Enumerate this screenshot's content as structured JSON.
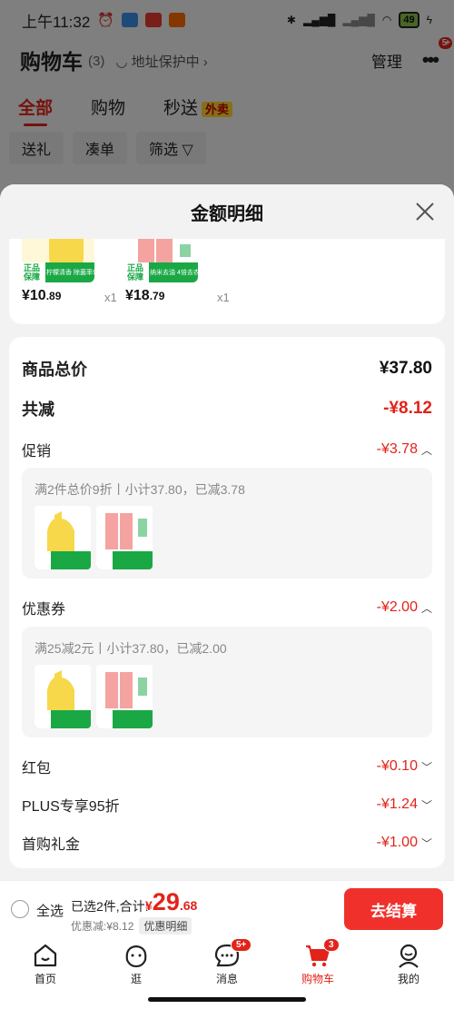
{
  "status_bar": {
    "time": "上午11:32",
    "battery": "49"
  },
  "cart_header": {
    "title": "购物车",
    "count": "(3)",
    "address_protect": "地址保护中",
    "manage": "管理",
    "more_badge": "5+"
  },
  "tabs": [
    {
      "label": "全部"
    },
    {
      "label": "购物"
    },
    {
      "label": "秒送"
    }
  ],
  "tab_tag": "外卖",
  "chips": [
    "送礼",
    "凑单",
    "筛选"
  ],
  "sheet": {
    "title": "金额明细",
    "products": [
      {
        "price_int": "¥10",
        "price_dec": ".89",
        "qty": "x1",
        "badge": "正品保障",
        "caption": "柠檬清香 除菌率99.9%"
      },
      {
        "price_int": "¥18",
        "price_dec": ".79",
        "qty": "x1",
        "badge": "正品保障",
        "caption": "纳米去油 4倍去农残"
      }
    ],
    "total_label": "商品总价",
    "total_value": "¥37.80",
    "reduce_label": "共减",
    "reduce_value": "-¥8.12",
    "promo_label": "促销",
    "promo_value": "-¥3.78",
    "promo_text": "满2件总价9折丨小计37.80，已减3.78",
    "coupon_label": "优惠券",
    "coupon_value": "-¥2.00",
    "coupon_text": "满25减2元丨小计37.80，已减2.00",
    "redpack_label": "红包",
    "redpack_value": "-¥0.10",
    "plus_label": "PLUS专享95折",
    "plus_value": "-¥1.24",
    "firstbuy_label": "首购礼金",
    "firstbuy_value": "-¥1.00"
  },
  "checkout": {
    "select_all": "全选",
    "selected_summary": "已选2件,合计:",
    "total_yen": "¥",
    "total_int": "29",
    "total_dec": ".68",
    "discount": "优惠减:¥8.12",
    "discount_detail": "优惠明细",
    "button": "去结算"
  },
  "nav": [
    {
      "label": "首页"
    },
    {
      "label": "逛"
    },
    {
      "label": "消息",
      "badge": "5+"
    },
    {
      "label": "购物车",
      "badge": "3"
    },
    {
      "label": "我的"
    }
  ],
  "colors": {
    "accent": "#e2231a",
    "checkout": "#f0312b",
    "guarantee_green": "#1aa845"
  }
}
